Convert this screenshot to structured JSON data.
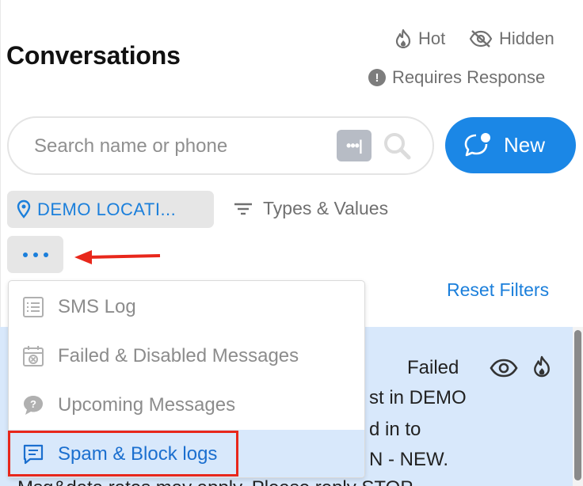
{
  "header": {
    "title": "Conversations",
    "filters": {
      "hot": "Hot",
      "hidden": "Hidden",
      "requires_response": "Requires Response"
    }
  },
  "search": {
    "placeholder": "Search name or phone",
    "value": ""
  },
  "new_button": {
    "label": "New"
  },
  "location_filter": {
    "label": "DEMO LOCATI..."
  },
  "types_filter": {
    "label": "Types & Values"
  },
  "reset_filters": {
    "label": "Reset Filters"
  },
  "menu": {
    "items": [
      {
        "label": "SMS Log",
        "icon": "list-icon"
      },
      {
        "label": "Failed & Disabled Messages",
        "icon": "calendar-x-icon"
      },
      {
        "label": "Upcoming Messages",
        "icon": "question-chat-icon"
      },
      {
        "label": "Spam & Block logs",
        "icon": "message-icon"
      }
    ],
    "active_index": 3
  },
  "conversation_preview": {
    "status": "Failed",
    "line1": "st in DEMO",
    "line2": "d in to",
    "line3": "N - NEW.",
    "line4": "Msg&data rates may apply. Please reply STOP"
  },
  "colors": {
    "accent": "#1b87e6",
    "link": "#1b7fdb",
    "annotation": "#e8271b",
    "row_highlight": "#d8e8fb"
  }
}
